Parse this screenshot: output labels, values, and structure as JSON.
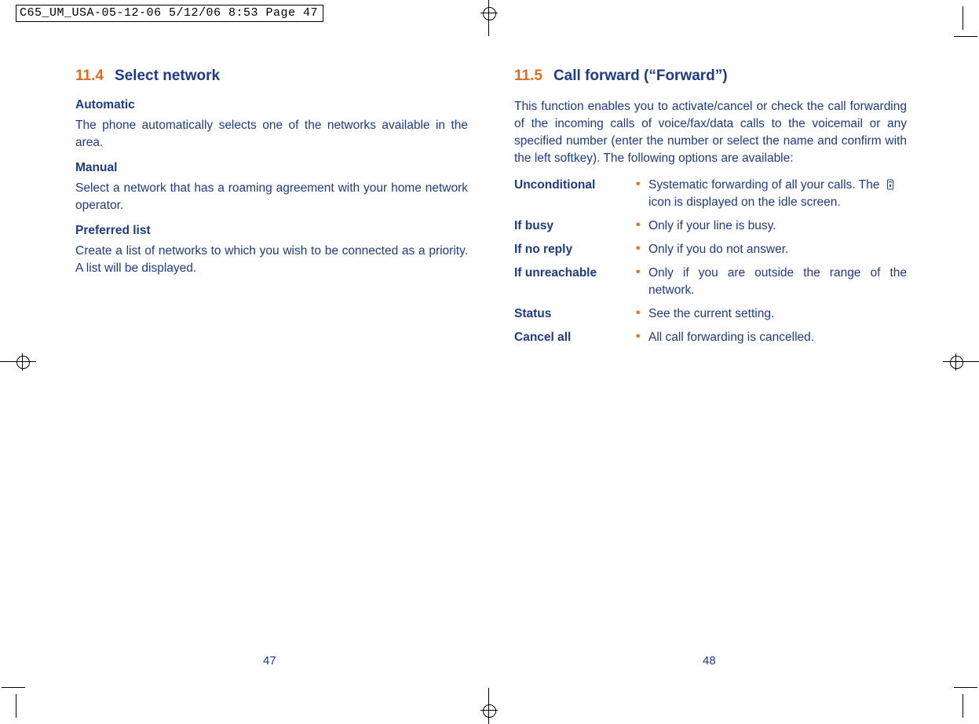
{
  "slug": "C65_UM_USA-05-12-06  5/12/06  8:53  Page 47",
  "left": {
    "section_number": "11.4",
    "section_title": "Select network",
    "blocks": [
      {
        "sub": "Automatic",
        "text": "The phone automatically selects one of the networks available in the area."
      },
      {
        "sub": "Manual",
        "text": "Select a network that has a roaming agreement with your home network operator."
      },
      {
        "sub": "Preferred list",
        "text": "Create a list of networks to which you wish to be connected as a priority. A list will be displayed."
      }
    ],
    "page_number": "47"
  },
  "right": {
    "section_number": "11.5",
    "section_title": "Call forward (“Forward”)",
    "intro": "This function enables you to activate/cancel or check the call forwarding of the incoming calls of voice/fax/data calls to the voicemail or any specified number (enter the number or select the name and confirm with the left softkey). The following options are available:",
    "options": [
      {
        "label": "Unconditional",
        "desc": "Systematic forwarding of all your calls. The",
        "desc2": "icon is displayed on the idle screen.",
        "has_icon": true
      },
      {
        "label": "If busy",
        "desc": "Only if your line is busy."
      },
      {
        "label": "If no reply",
        "desc": "Only if you do not answer."
      },
      {
        "label": "If unreachable",
        "desc": "Only if you are outside the range of the network."
      },
      {
        "label": "Status",
        "desc": "See the current setting."
      },
      {
        "label": "Cancel all",
        "desc": "All call forwarding is cancelled."
      }
    ],
    "page_number": "48"
  }
}
